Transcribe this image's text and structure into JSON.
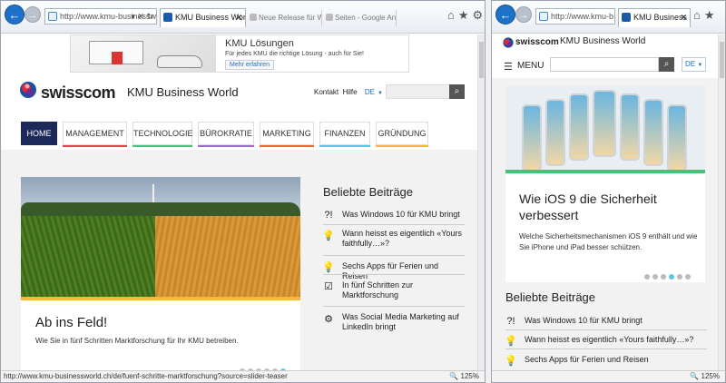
{
  "left": {
    "address": "http://www.kmu-businessworl...",
    "tab_active": "KMU Business World | Mod...",
    "tab_others": [
      "Neue Release für Win...",
      "Seiten - Google Analytics"
    ],
    "ad": {
      "title": "KMU Lösungen",
      "subtitle": "Für jedes KMU die richtige Lösung - auch für Sie!",
      "button": "Mehr erfahren"
    },
    "brand": "swisscom",
    "site_name": "KMU Business World",
    "topnav": {
      "contact": "Kontakt",
      "help": "Hilfe",
      "lang": "DE"
    },
    "menu": [
      {
        "label": "HOME",
        "color": "#1b2a5b"
      },
      {
        "label": "MANAGEMENT",
        "color": "#e0434b"
      },
      {
        "label": "TECHNOLOGIE",
        "color": "#4cbf79"
      },
      {
        "label": "BÜROKRATIE",
        "color": "#9a6cc7"
      },
      {
        "label": "MARKETING",
        "color": "#e8662f"
      },
      {
        "label": "FINANZEN",
        "color": "#5bc4e8"
      },
      {
        "label": "GRÜNDUNG",
        "color": "#f5b83a"
      }
    ],
    "hero": {
      "title": "Ab ins Feld!",
      "description": "Wie Sie in fünf Schritten Marktforschung für Ihr KMU betreiben."
    },
    "popular_title": "Beliebte Beiträge",
    "popular": [
      {
        "icon": "?!",
        "text": "Was Windows 10 für KMU bringt"
      },
      {
        "icon": "💡",
        "text": "Wann heisst es eigentlich «Yours faithfully…»?"
      },
      {
        "icon": "💡",
        "text": "Sechs Apps für Ferien und Reisen"
      },
      {
        "icon": "☑",
        "text": "In fünf Schritten zur Marktforschung"
      },
      {
        "icon": "⚙",
        "text": "Was Social Media Marketing auf LinkedIn bringt"
      }
    ],
    "status_url": "http://www.kmu-businessworld.ch/de/fuenf-schritte-marktforschung?source=slider-teaser",
    "zoom": "125%"
  },
  "right": {
    "address": "http://www.kmu-b...",
    "tab_active": "KMU Business ...",
    "brand": "swisscom",
    "site_name": "KMU Business World",
    "menu_label": "MENU",
    "lang": "DE",
    "card": {
      "title": "Wie iOS 9 die Sicherheit verbessert",
      "description": "Welche Sicherheitsmechanismen iOS 9 enthält und wie Sie iPhone und iPad besser schützen."
    },
    "popular_title": "Beliebte Beiträge",
    "popular": [
      {
        "icon": "?!",
        "text": "Was Windows 10 für KMU bringt"
      },
      {
        "icon": "💡",
        "text": "Wann heisst es eigentlich «Yours faithfully…»?"
      },
      {
        "icon": "💡",
        "text": "Sechs Apps für Ferien und Reisen"
      }
    ],
    "zoom": "125%"
  },
  "colors": {
    "brand_navy": "#1b2a5b",
    "accent_blue": "#5bc4e8",
    "ie_blue": "#1d71c8"
  }
}
